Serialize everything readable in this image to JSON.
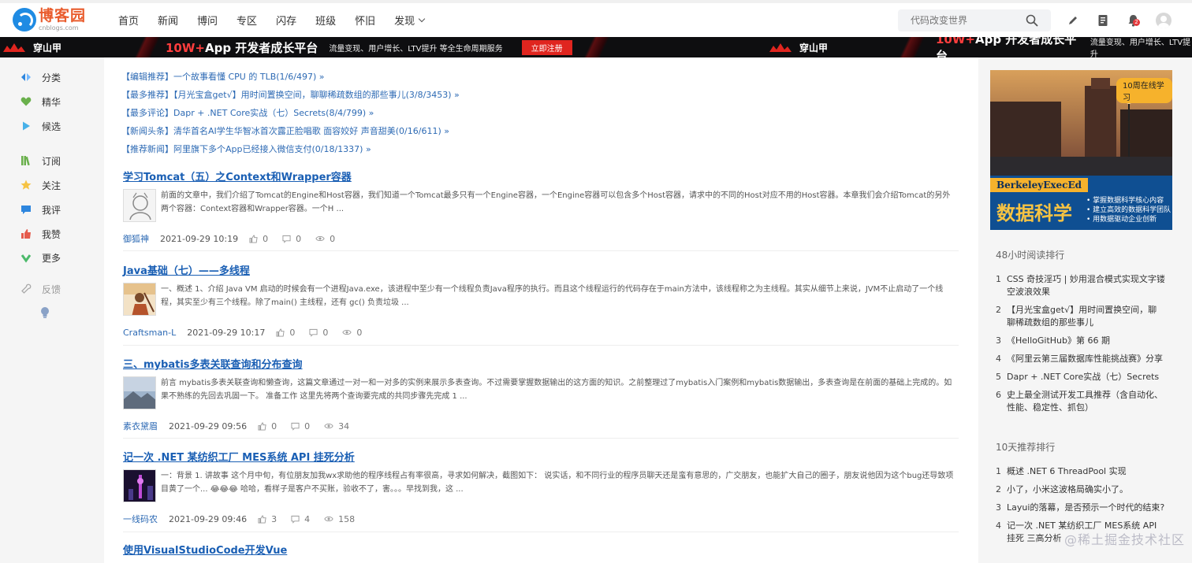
{
  "site": {
    "logo_cn": "博客园",
    "logo_en": "cnblogs.com"
  },
  "nav": {
    "items": [
      "首页",
      "新闻",
      "博问",
      "专区",
      "闪存",
      "班级",
      "怀旧",
      "发现"
    ]
  },
  "search": {
    "placeholder": "代码改变世界"
  },
  "toolbar": {
    "notification_count": "2"
  },
  "banner": {
    "brand": "穿山甲",
    "title_prefix": "10W+",
    "title_rest": "App 开发者成长平台",
    "sub": "流量变现、用户增长、LTV提升 等全生命周期服务",
    "cta": "立即注册",
    "repeat_sub": "流量变现、用户增长、LTV提升"
  },
  "leftbar": {
    "items": [
      "分类",
      "精华",
      "候选",
      "订阅",
      "关注",
      "我评",
      "我赞",
      "更多",
      "反馈"
    ]
  },
  "headlines": [
    {
      "tag": "【编辑推荐】",
      "text": "一个故事看懂 CPU 的 TLB(1/6/497) »"
    },
    {
      "tag": "【最多推荐】",
      "text": "【月光宝盒get√】用时间置换空间，聊聊稀疏数组的那些事儿(3/8/3453) »"
    },
    {
      "tag": "【最多评论】",
      "text": "Dapr + .NET Core实战（七）Secrets(8/4/799) »"
    },
    {
      "tag": "【新闻头条】",
      "text": "清华首名AI学生华智冰首次露正脸唱歌 面容姣好 声音甜美(0/16/611) »"
    },
    {
      "tag": "【推荐新闻】",
      "text": "阿里旗下多个App已经接入微信支付(0/18/1337) »"
    }
  ],
  "posts": [
    {
      "title": "学习Tomcat（五）之Context和Wrapper容器",
      "summary": "前面的文章中，我们介绍了Tomcat的Engine和Host容器，我们知道一个Tomcat最多只有一个Engine容器，一个Engine容器可以包含多个Host容器，请求中的不同的Host对应不用的Host容器。本章我们会介绍Tomcat的另外两个容器：Context容器和Wrapper容器。一个H ...",
      "author": "御狐神",
      "date": "2021-09-29 10:19",
      "likes": "0",
      "comments": "0",
      "views": "0"
    },
    {
      "title": "Java基础（七）——多线程",
      "summary": "一、概述 1、介绍 Java VM 启动的时候会有一个进程Java.exe，该进程中至少有一个线程负责Java程序的执行。而且这个线程运行的代码存在于main方法中，该线程称之为主线程。其实从细节上来说，JVM不止启动了一个线程，其实至少有三个线程。除了main() 主线程，还有 gc() 负责垃圾 ...",
      "author": "Craftsman-L",
      "date": "2021-09-29 10:17",
      "likes": "0",
      "comments": "0",
      "views": "0"
    },
    {
      "title": "三、mybatis多表关联查询和分布查询",
      "summary": "前言 mybatis多表关联查询和懒查询，这篇文章通过一对一和一对多的实例来展示多表查询。不过需要掌握数据输出的这方面的知识。之前整理过了mybatis入门案例和mybatis数据输出，多表查询是在前面的基础上完成的。如果不熟练的先回去巩固一下。 准备工作 这里先将两个查询要完成的共同步骤先完成 1 ...",
      "author": "素衣黛眉",
      "date": "2021-09-29 09:56",
      "likes": "0",
      "comments": "0",
      "views": "34"
    },
    {
      "title": "记一次 .NET 某纺织工厂 MES系统 API 挂死分析",
      "summary": "一：背景 1. 讲故事 这个月中旬，有位朋友加我wx求助他的程序线程占有率很高，寻求如何解决，截图如下： 说实话，和不同行业的程序员聊天还是蛮有意思的，广交朋友，也能扩大自己的圈子，朋友说他因为这个bug还导致项目黄了一个... 😂😂😂 哈哈，看样子是客户不买账，验收不了，害。。。早找到我，这 ...",
      "author": "一线码农",
      "date": "2021-09-29 09:46",
      "likes": "3",
      "comments": "4",
      "views": "158"
    },
    {
      "title": "使用VisualStudioCode开发Vue",
      "summary": "",
      "author": "",
      "date": "",
      "likes": "",
      "comments": "",
      "views": ""
    }
  ],
  "ad": {
    "badge": "10周在线学习",
    "brand": "BerkeleyExecEd",
    "headline": "数据科学",
    "points": [
      "掌握数据科学核心内容",
      "建立高效的数据科学团队",
      "用数据驱动企业创新"
    ]
  },
  "rank48": {
    "title": "48小时阅读排行",
    "items": [
      "CSS 奇技淫巧 | 妙用混合模式实现文字镂空波浪效果",
      "【月光宝盒get√】用时间置换空间，聊聊稀疏数组的那些事儿",
      "《HelloGitHub》第 66 期",
      "《阿里云第三届数据库性能挑战赛》分享",
      "Dapr + .NET Core实战（七）Secrets",
      "史上最全测试开发工具推荐（含自动化、性能、稳定性、抓包）"
    ]
  },
  "rank10": {
    "title": "10天推荐排行",
    "items": [
      "概述 .NET 6 ThreadPool 实现",
      "小了，小米这波格局确实小了。",
      "Layui的落幕，是否预示一个时代的结束?",
      "记一次 .NET 某纺织工厂 MES系统 API 挂死 三高分析"
    ]
  },
  "watermark": "@稀土掘金技术社区",
  "colors": {
    "link": "#1a5fb4",
    "accent": "#e95c2d",
    "banner_bg": "#0e0e10",
    "cta": "#e0251f"
  }
}
